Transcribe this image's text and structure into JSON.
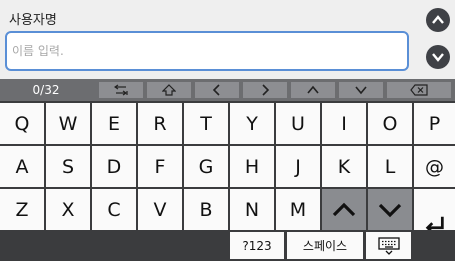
{
  "field": {
    "label": "사용자명",
    "placeholder": "이름 입력."
  },
  "side_buttons": [
    {
      "icon": "chevron-up-icon"
    },
    {
      "icon": "chevron-down-icon"
    }
  ],
  "toolbar": {
    "counter": "0/32",
    "icons": [
      "tab-icon",
      "shift-icon",
      "arrow-left-icon",
      "arrow-right-icon",
      "chevron-up-icon",
      "chevron-down-icon",
      "backspace-icon"
    ]
  },
  "rows": [
    [
      "Q",
      "W",
      "E",
      "R",
      "T",
      "Y",
      "U",
      "I",
      "O",
      "P"
    ],
    [
      "A",
      "S",
      "D",
      "F",
      "G",
      "H",
      "J",
      "K",
      "L",
      "@"
    ],
    [
      "Z",
      "X",
      "C",
      "V",
      "B",
      "N",
      "M"
    ]
  ],
  "bottom": {
    "symbols_label": "?123",
    "space_label": "스페이스"
  },
  "colors": {
    "accent": "#5a8fd6",
    "keyboard_bg": "#3b3c3e",
    "key_bg": "#fafafa",
    "dark_key_bg": "#8a8c90",
    "toolbar_bg": "#6c6d70"
  }
}
